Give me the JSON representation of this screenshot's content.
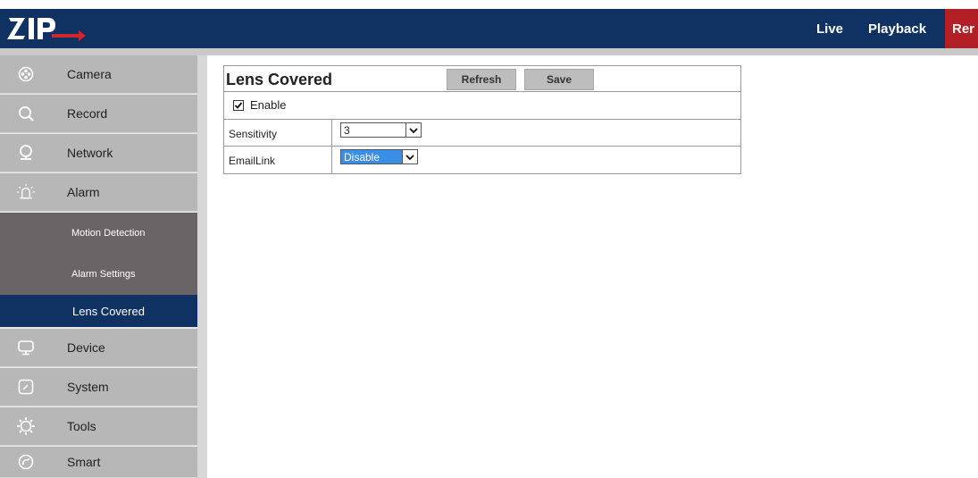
{
  "header": {
    "nav": [
      "Live",
      "Playback",
      "Rer"
    ],
    "colors": {
      "bar": "#0f3263",
      "active_nav": "#b21f24"
    }
  },
  "sidebar": {
    "items": [
      {
        "label": "Camera",
        "icon": "camera-icon"
      },
      {
        "label": "Record",
        "icon": "search-icon"
      },
      {
        "label": "Network",
        "icon": "network-icon"
      },
      {
        "label": "Alarm",
        "icon": "alarm-icon"
      }
    ],
    "subitems": [
      {
        "label": "Motion Detection"
      },
      {
        "label": "Alarm Settings"
      },
      {
        "label": "Lens Covered",
        "active": true
      }
    ],
    "items_after": [
      {
        "label": "Device",
        "icon": "monitor-icon"
      },
      {
        "label": "System",
        "icon": "system-icon"
      },
      {
        "label": "Tools",
        "icon": "gear-icon"
      },
      {
        "label": "Smart",
        "icon": "smart-icon"
      }
    ]
  },
  "panel": {
    "title": "Lens Covered",
    "refresh_label": "Refresh",
    "save_label": "Save",
    "enable_label": "Enable",
    "enable_checked": true,
    "sensitivity_label": "Sensitivity",
    "sensitivity_value": "3",
    "emaillink_label": "EmailLink",
    "emaillink_value": "Disable"
  }
}
